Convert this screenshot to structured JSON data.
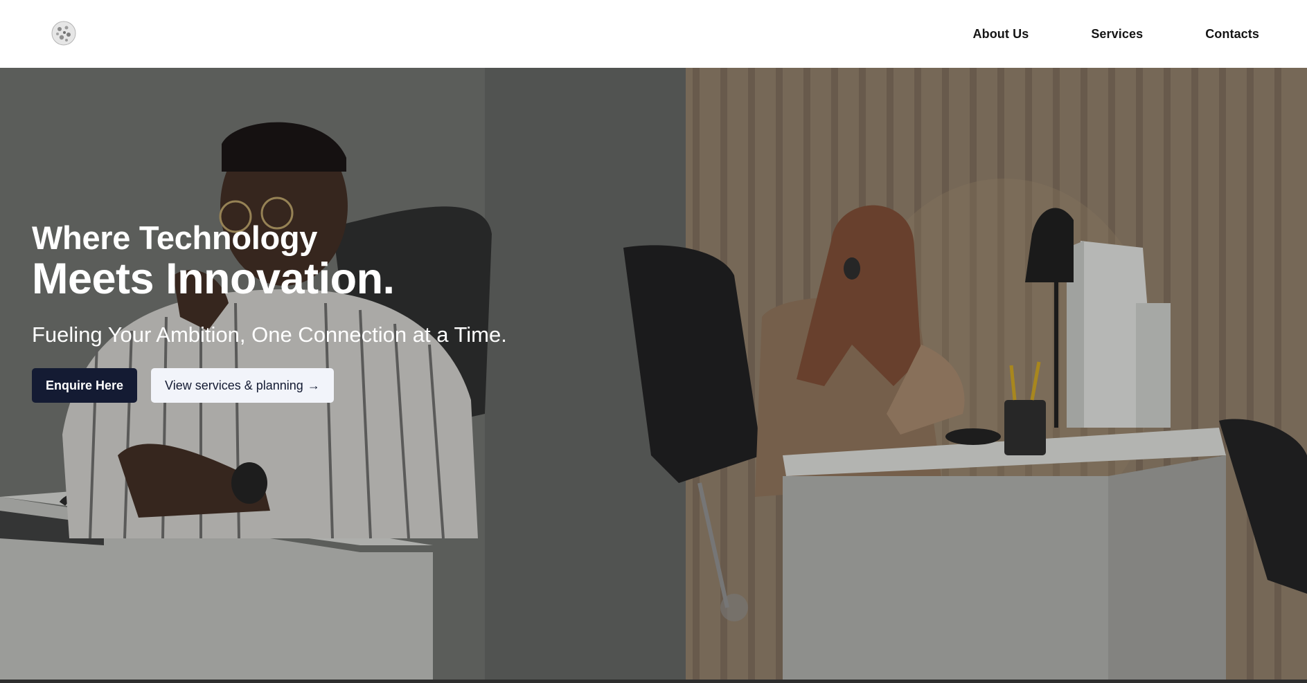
{
  "nav": {
    "logo_alt": "logo",
    "links": [
      {
        "label": "About Us"
      },
      {
        "label": "Services"
      },
      {
        "label": "Contacts"
      }
    ]
  },
  "hero": {
    "title_line1": "Where Technology",
    "title_line2": "Meets Innovation.",
    "subtitle": "Fueling Your Ambition, One Connection at a Time.",
    "primary_button": "Enquire Here",
    "secondary_button": "View services & planning",
    "secondary_button_icon": "arrow-right-icon",
    "secondary_button_arrow": "→"
  },
  "colors": {
    "primary_button_bg": "#141b33",
    "secondary_button_bg": "#f2f4fa",
    "header_bg": "#ffffff",
    "text_light": "#ffffff"
  }
}
